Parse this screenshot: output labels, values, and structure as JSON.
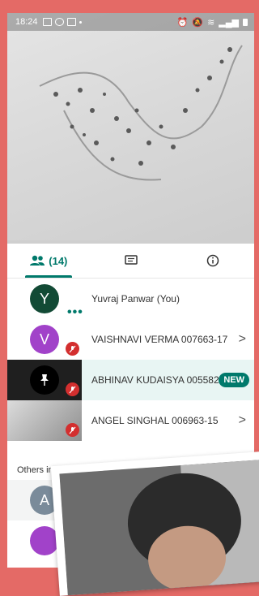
{
  "status_bar": {
    "time": "18:24"
  },
  "tabs": [
    {
      "id": "participants",
      "icon": "people-icon",
      "count": "(14)",
      "active": true
    },
    {
      "id": "chat",
      "icon": "chat-icon",
      "active": false
    },
    {
      "id": "info",
      "icon": "info-icon",
      "active": false
    }
  ],
  "participants": [
    {
      "initial": "Y",
      "name": "Yuvraj Panwar (You)",
      "avatar_color": "#124a35",
      "muted": false,
      "speaking": true
    },
    {
      "initial": "V",
      "name": "VAISHNAVI VERMA 007663-17",
      "avatar_color": "#a142c9",
      "muted": true,
      "chevron": ">"
    },
    {
      "name": "ABHINAV KUDAISYA 005582...",
      "pinned": true,
      "muted": true,
      "badge": "NEW",
      "highlight_color": "#e8f5f3"
    },
    {
      "name": "ANGEL SINGHAL 006963-15",
      "muted": true,
      "chevron": ">"
    }
  ],
  "others_section": {
    "label": "Others in"
  },
  "others": [
    {
      "initial": "A",
      "avatar_color": "#7a8b9a"
    },
    {
      "avatar_color": "#a142c9"
    }
  ],
  "colors": {
    "accent": "#00796b",
    "mute": "#d32f2f",
    "background_frame": "#e46a66"
  }
}
